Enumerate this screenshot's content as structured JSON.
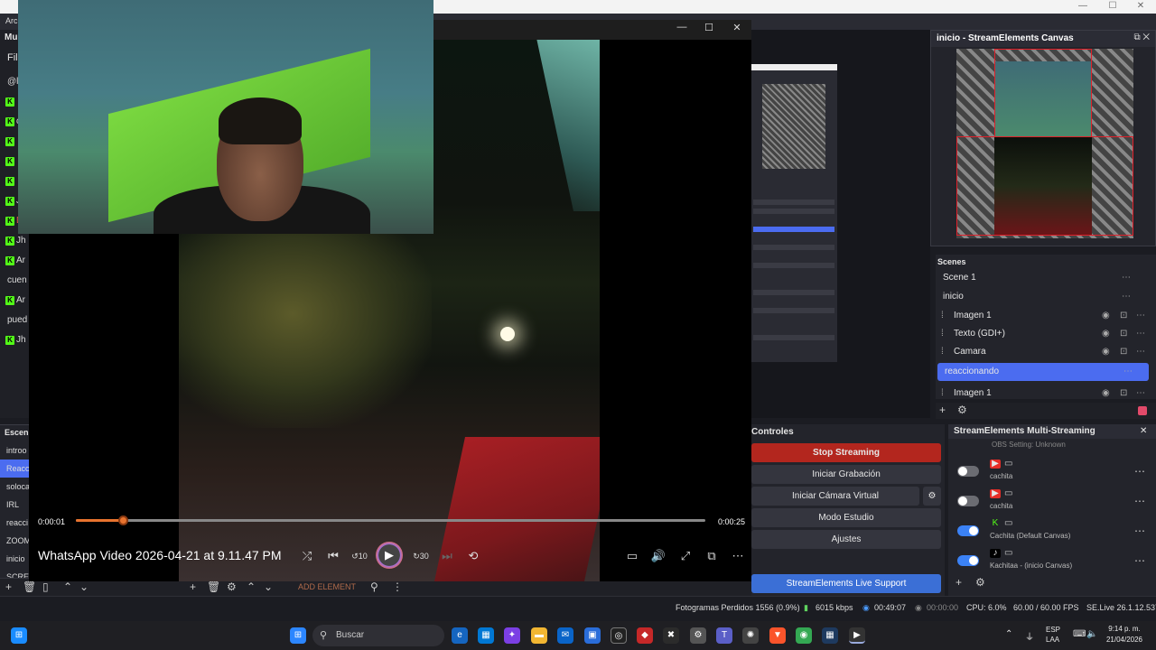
{
  "obs": {
    "menu_partial": "Arc",
    "chat_header_partial": "Mu",
    "chat_filter_partial": "Fil"
  },
  "chat": [
    {
      "text": "@l",
      "kick": false
    },
    {
      "text": "",
      "kick": true
    },
    {
      "text": "ca",
      "kick": true
    },
    {
      "text": "",
      "kick": true
    },
    {
      "text": "",
      "kick": true
    },
    {
      "text": "",
      "kick": true
    },
    {
      "text": "Jh",
      "kick": true
    },
    {
      "text": "Da",
      "kick": true
    },
    {
      "text": "Jh",
      "kick": true
    },
    {
      "text": "Ar",
      "kick": true
    },
    {
      "text": "cuen",
      "kick": false
    },
    {
      "text": "Ar",
      "kick": true
    },
    {
      "text": "pued",
      "kick": false
    },
    {
      "text": "Jh",
      "kick": true
    }
  ],
  "scenes_left": {
    "header": "Escen",
    "items": [
      "introo",
      "Reacc",
      "soloca",
      "IRL",
      "reacci",
      "ZOOM",
      "inicio",
      "SCREE"
    ],
    "active_index": 1
  },
  "player": {
    "title": "WhatsApp Video 2026-04-21 at 9.11.47 PM",
    "time_current": "0:00:01",
    "time_total": "0:00:25",
    "progress": 0.075,
    "win_min": "—",
    "win_max": "☐",
    "win_close": "✕"
  },
  "bottom_toolbar": {
    "add_element": "ADD ELEMENT"
  },
  "se_canvas": {
    "title": "inicio - StreamElements Canvas"
  },
  "scenes": {
    "header": "Scenes",
    "rows": [
      {
        "label": "Scene 1",
        "type": "scene"
      },
      {
        "label": "inicio",
        "type": "scene"
      },
      {
        "label": "Imagen 1",
        "type": "source"
      },
      {
        "label": "Texto (GDI+)",
        "type": "source"
      },
      {
        "label": "Camara",
        "type": "source"
      },
      {
        "label": "reaccionando",
        "type": "scene-active"
      },
      {
        "label": "Imagen 1",
        "type": "source"
      }
    ]
  },
  "controls": {
    "title": "Controles",
    "stop_streaming": "Stop Streaming",
    "start_recording": "Iniciar Grabación",
    "virtual_cam": "Iniciar Cámara Virtual",
    "studio_mode": "Modo Estudio",
    "settings": "Ajustes",
    "support": "StreamElements Live Support"
  },
  "multistream": {
    "title": "StreamElements Multi-Streaming",
    "partial_top": "OBS Setting: Unknown",
    "rows": [
      {
        "name": "cachita",
        "on": false,
        "platform": "youtube"
      },
      {
        "name": "cachita",
        "on": false,
        "platform": "youtube"
      },
      {
        "name": "Cachita (Default Canvas)",
        "on": true,
        "platform": "kick"
      },
      {
        "name": "Kachitaa - (inicio Canvas)",
        "on": true,
        "platform": "tiktok"
      }
    ]
  },
  "status": {
    "dropped": "Fotogramas Perdidos 1556 (0.9%)",
    "bitrate": "6015 kbps",
    "stream_time": "00:49:07",
    "rec_time": "00:00:00",
    "cpu": "CPU: 6.0%",
    "fps": "60.00 / 60.00 FPS",
    "version": "SE.Live 26.1.12.537"
  },
  "taskbar": {
    "search_placeholder": "Buscar",
    "lang_top": "ESP",
    "lang_bottom": "LAA",
    "time": "9:14 p. m.",
    "date": "21/04/2026"
  },
  "colors": {
    "accent": "#4b6cf0",
    "stop_red": "#b3261e",
    "kick_green": "#53fc18",
    "progress_orange": "#e8732e"
  }
}
